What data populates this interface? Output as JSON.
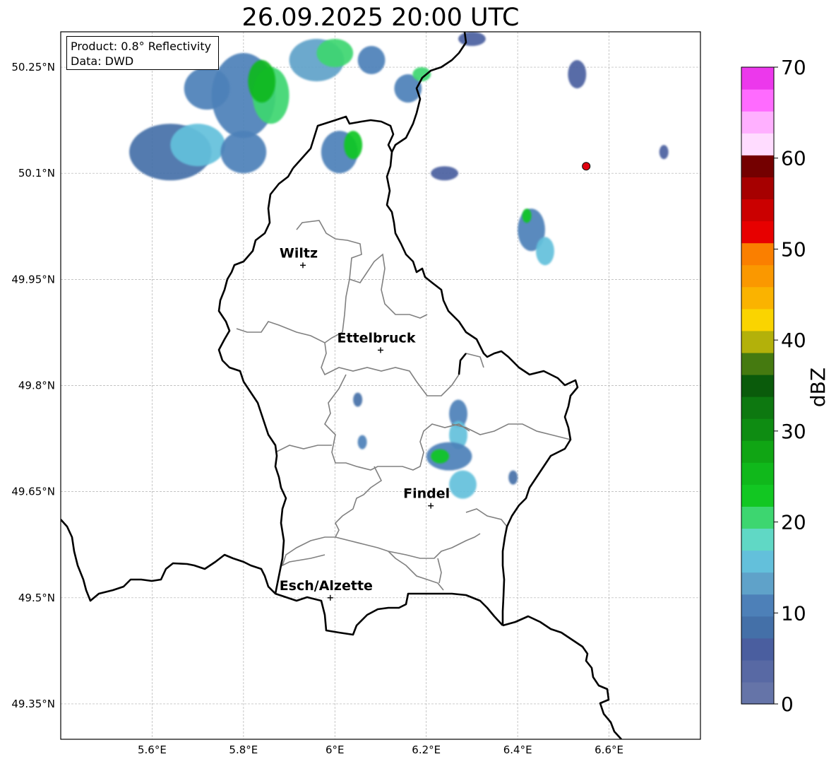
{
  "title": "26.09.2025 20:00 UTC",
  "info": {
    "product": "Product: 0.8° Reflectivity",
    "source": "Data: DWD"
  },
  "map": {
    "extent": {
      "lon": [
        5.4,
        6.8
      ],
      "lat": [
        49.3,
        50.3
      ]
    },
    "lat_ticks": [
      {
        "value": 50.25,
        "label": "50.25°N"
      },
      {
        "value": 50.1,
        "label": "50.1°N"
      },
      {
        "value": 49.95,
        "label": "49.95°N"
      },
      {
        "value": 49.8,
        "label": "49.8°N"
      },
      {
        "value": 49.65,
        "label": "49.65°N"
      },
      {
        "value": 49.5,
        "label": "49.5°N"
      },
      {
        "value": 49.35,
        "label": "49.35°N"
      }
    ],
    "lon_ticks": [
      {
        "value": 5.6,
        "label": "5.6°E"
      },
      {
        "value": 5.8,
        "label": "5.8°E"
      },
      {
        "value": 6.0,
        "label": "6°E"
      },
      {
        "value": 6.2,
        "label": "6.2°E"
      },
      {
        "value": 6.4,
        "label": "6.4°E"
      },
      {
        "value": 6.6,
        "label": "6.6°E"
      }
    ],
    "cities": [
      {
        "name": "Wiltz",
        "lon": 5.93,
        "lat": 49.97
      },
      {
        "name": "Ettelbruck",
        "lon": 6.1,
        "lat": 49.85
      },
      {
        "name": "Findel",
        "lon": 6.21,
        "lat": 49.63
      },
      {
        "name": "Esch/Alzette",
        "lon": 5.99,
        "lat": 49.5
      }
    ],
    "radar_site": {
      "lon": 6.55,
      "lat": 50.11,
      "color": "#e0000f"
    },
    "border_color": "#000000",
    "canton_color": "#808080",
    "echoes": [
      {
        "lon": 5.64,
        "lat": 50.13,
        "rx": 0.09,
        "ry": 0.04,
        "dbz": 9
      },
      {
        "lon": 5.7,
        "lat": 50.14,
        "rx": 0.06,
        "ry": 0.03,
        "dbz": 15
      },
      {
        "lon": 5.8,
        "lat": 50.13,
        "rx": 0.05,
        "ry": 0.03,
        "dbz": 12
      },
      {
        "lon": 5.8,
        "lat": 50.21,
        "rx": 0.07,
        "ry": 0.06,
        "dbz": 10
      },
      {
        "lon": 5.86,
        "lat": 50.21,
        "rx": 0.04,
        "ry": 0.04,
        "dbz": 21
      },
      {
        "lon": 5.84,
        "lat": 50.23,
        "rx": 0.03,
        "ry": 0.03,
        "dbz": 25
      },
      {
        "lon": 5.72,
        "lat": 50.22,
        "rx": 0.05,
        "ry": 0.03,
        "dbz": 12
      },
      {
        "lon": 5.96,
        "lat": 50.26,
        "rx": 0.06,
        "ry": 0.03,
        "dbz": 13
      },
      {
        "lon": 6.0,
        "lat": 50.27,
        "rx": 0.04,
        "ry": 0.02,
        "dbz": 21
      },
      {
        "lon": 6.08,
        "lat": 50.26,
        "rx": 0.03,
        "ry": 0.02,
        "dbz": 10
      },
      {
        "lon": 6.01,
        "lat": 50.13,
        "rx": 0.04,
        "ry": 0.03,
        "dbz": 11
      },
      {
        "lon": 6.04,
        "lat": 50.14,
        "rx": 0.02,
        "ry": 0.02,
        "dbz": 22
      },
      {
        "lon": 6.16,
        "lat": 50.22,
        "rx": 0.03,
        "ry": 0.02,
        "dbz": 11
      },
      {
        "lon": 6.19,
        "lat": 50.24,
        "rx": 0.02,
        "ry": 0.01,
        "dbz": 21
      },
      {
        "lon": 6.24,
        "lat": 50.1,
        "rx": 0.03,
        "ry": 0.01,
        "dbz": 6
      },
      {
        "lon": 6.3,
        "lat": 50.29,
        "rx": 0.03,
        "ry": 0.01,
        "dbz": 7
      },
      {
        "lon": 6.43,
        "lat": 50.02,
        "rx": 0.03,
        "ry": 0.03,
        "dbz": 12
      },
      {
        "lon": 6.42,
        "lat": 50.04,
        "rx": 0.01,
        "ry": 0.01,
        "dbz": 24
      },
      {
        "lon": 6.46,
        "lat": 49.99,
        "rx": 0.02,
        "ry": 0.02,
        "dbz": 16
      },
      {
        "lon": 6.53,
        "lat": 50.24,
        "rx": 0.02,
        "ry": 0.02,
        "dbz": 5
      },
      {
        "lon": 6.72,
        "lat": 50.13,
        "rx": 0.01,
        "ry": 0.01,
        "dbz": 6
      },
      {
        "lon": 6.05,
        "lat": 49.78,
        "rx": 0.01,
        "ry": 0.01,
        "dbz": 9
      },
      {
        "lon": 6.06,
        "lat": 49.72,
        "rx": 0.01,
        "ry": 0.01,
        "dbz": 12
      },
      {
        "lon": 6.27,
        "lat": 49.76,
        "rx": 0.02,
        "ry": 0.02,
        "dbz": 11
      },
      {
        "lon": 6.27,
        "lat": 49.73,
        "rx": 0.02,
        "ry": 0.02,
        "dbz": 16
      },
      {
        "lon": 6.25,
        "lat": 49.7,
        "rx": 0.05,
        "ry": 0.02,
        "dbz": 12
      },
      {
        "lon": 6.23,
        "lat": 49.7,
        "rx": 0.02,
        "ry": 0.01,
        "dbz": 22
      },
      {
        "lon": 6.28,
        "lat": 49.66,
        "rx": 0.03,
        "ry": 0.02,
        "dbz": 15
      },
      {
        "lon": 6.39,
        "lat": 49.67,
        "rx": 0.01,
        "ry": 0.01,
        "dbz": 8
      }
    ]
  },
  "colorbar": {
    "label": "dBZ",
    "min": 0,
    "max": 70,
    "ticks": [
      "0",
      "10",
      "20",
      "30",
      "40",
      "50",
      "60",
      "70"
    ],
    "colors": [
      "#6574a8",
      "#5869a4",
      "#4a5e9f",
      "#4470a8",
      "#4d80b8",
      "#5fa2c9",
      "#63c0db",
      "#60d8c5",
      "#3dd670",
      "#12c722",
      "#10b81b",
      "#10a514",
      "#0e8c12",
      "#0d7810",
      "#0a5b0b",
      "#457a10",
      "#b3b10a",
      "#fad400",
      "#fab300",
      "#fa9800",
      "#fa7f00",
      "#e70000",
      "#cb0000",
      "#a60000",
      "#740000",
      "#ffdcff",
      "#ffb0ff",
      "#ff6bff",
      "#ec38ec"
    ]
  }
}
